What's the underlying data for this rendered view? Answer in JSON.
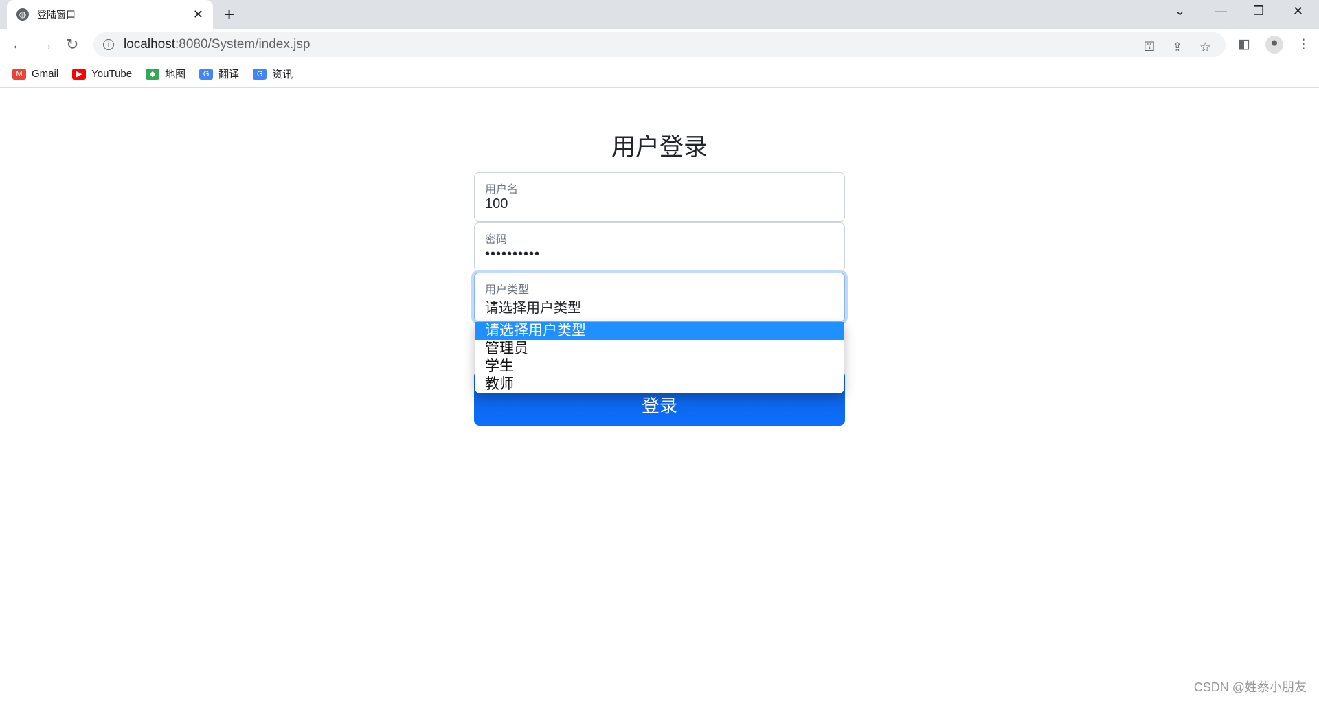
{
  "browser": {
    "tab_title": "登陆窗口",
    "url_host": "localhost",
    "url_rest": ":8080/System/index.jsp",
    "bookmarks": [
      {
        "label": "Gmail",
        "icon": "gmail-icon",
        "color": "#ea4335"
      },
      {
        "label": "YouTube",
        "icon": "youtube-icon",
        "color": "#ff0000"
      },
      {
        "label": "地图",
        "icon": "maps-icon",
        "color": "#34a853"
      },
      {
        "label": "翻译",
        "icon": "translate-icon",
        "color": "#4285f4"
      },
      {
        "label": "资讯",
        "icon": "news-icon",
        "color": "#4285f4"
      }
    ]
  },
  "page": {
    "title": "用户登录",
    "username_label": "用户名",
    "username_value": "100",
    "password_label": "密码",
    "password_value": "••••••••••",
    "usertype_label": "用户类型",
    "usertype_value": "请选择用户类型",
    "usertype_options": [
      "请选择用户类型",
      "管理员",
      "学生",
      "教师"
    ],
    "login_button": "登录",
    "accent_color": "#0d6efd",
    "selected_option_color": "#1e90ff"
  },
  "watermark": "CSDN @姓蔡小朋友"
}
